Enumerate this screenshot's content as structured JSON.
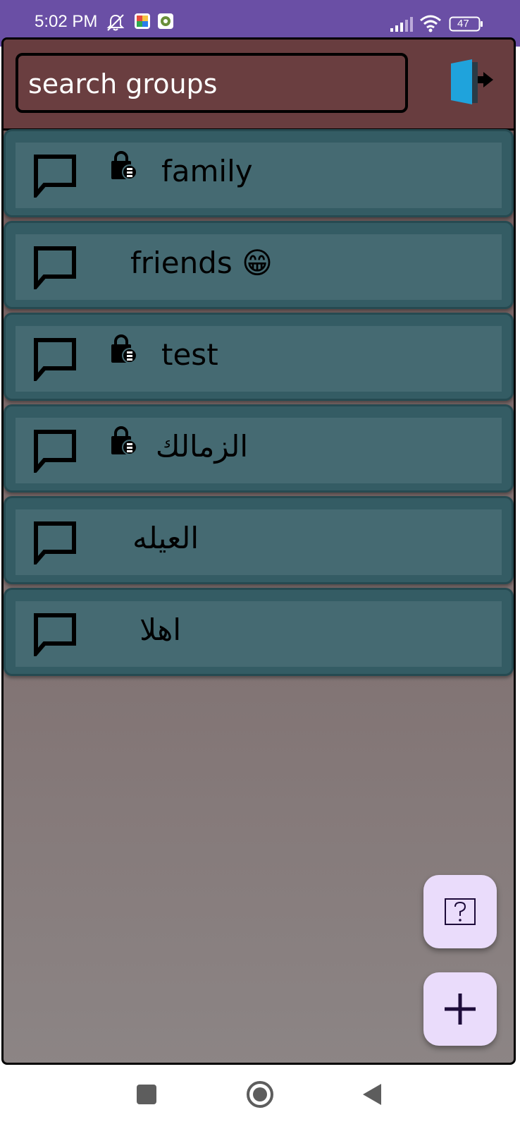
{
  "status_bar": {
    "time": "5:02 PM",
    "battery": "47",
    "icons": [
      "mute-bell-icon",
      "colorful-app-icon",
      "app-notification-icon",
      "signal-icon",
      "wifi-icon",
      "battery-icon"
    ]
  },
  "header": {
    "search_placeholder": "search groups",
    "logout_icon": "exit-door-icon"
  },
  "groups": [
    {
      "name": "family",
      "locked": true
    },
    {
      "name": "friends 😁",
      "locked": false
    },
    {
      "name": "test",
      "locked": true
    },
    {
      "name": "الزمالك",
      "locked": true
    },
    {
      "name": "العيله",
      "locked": false
    },
    {
      "name": "اهلا",
      "locked": false
    }
  ],
  "fabs": {
    "help_icon": "help-question-icon",
    "add_icon": "plus-icon"
  },
  "nav": {
    "icons": [
      "recents-square-icon",
      "home-circle-icon",
      "back-triangle-icon"
    ]
  },
  "colors": {
    "status_bar": "#6a4fa5",
    "header": "#683d3f",
    "card": "#345c64",
    "card_inner": "#456a72",
    "fab": "#eadcfb",
    "logout_door": "#1fa3dc"
  }
}
